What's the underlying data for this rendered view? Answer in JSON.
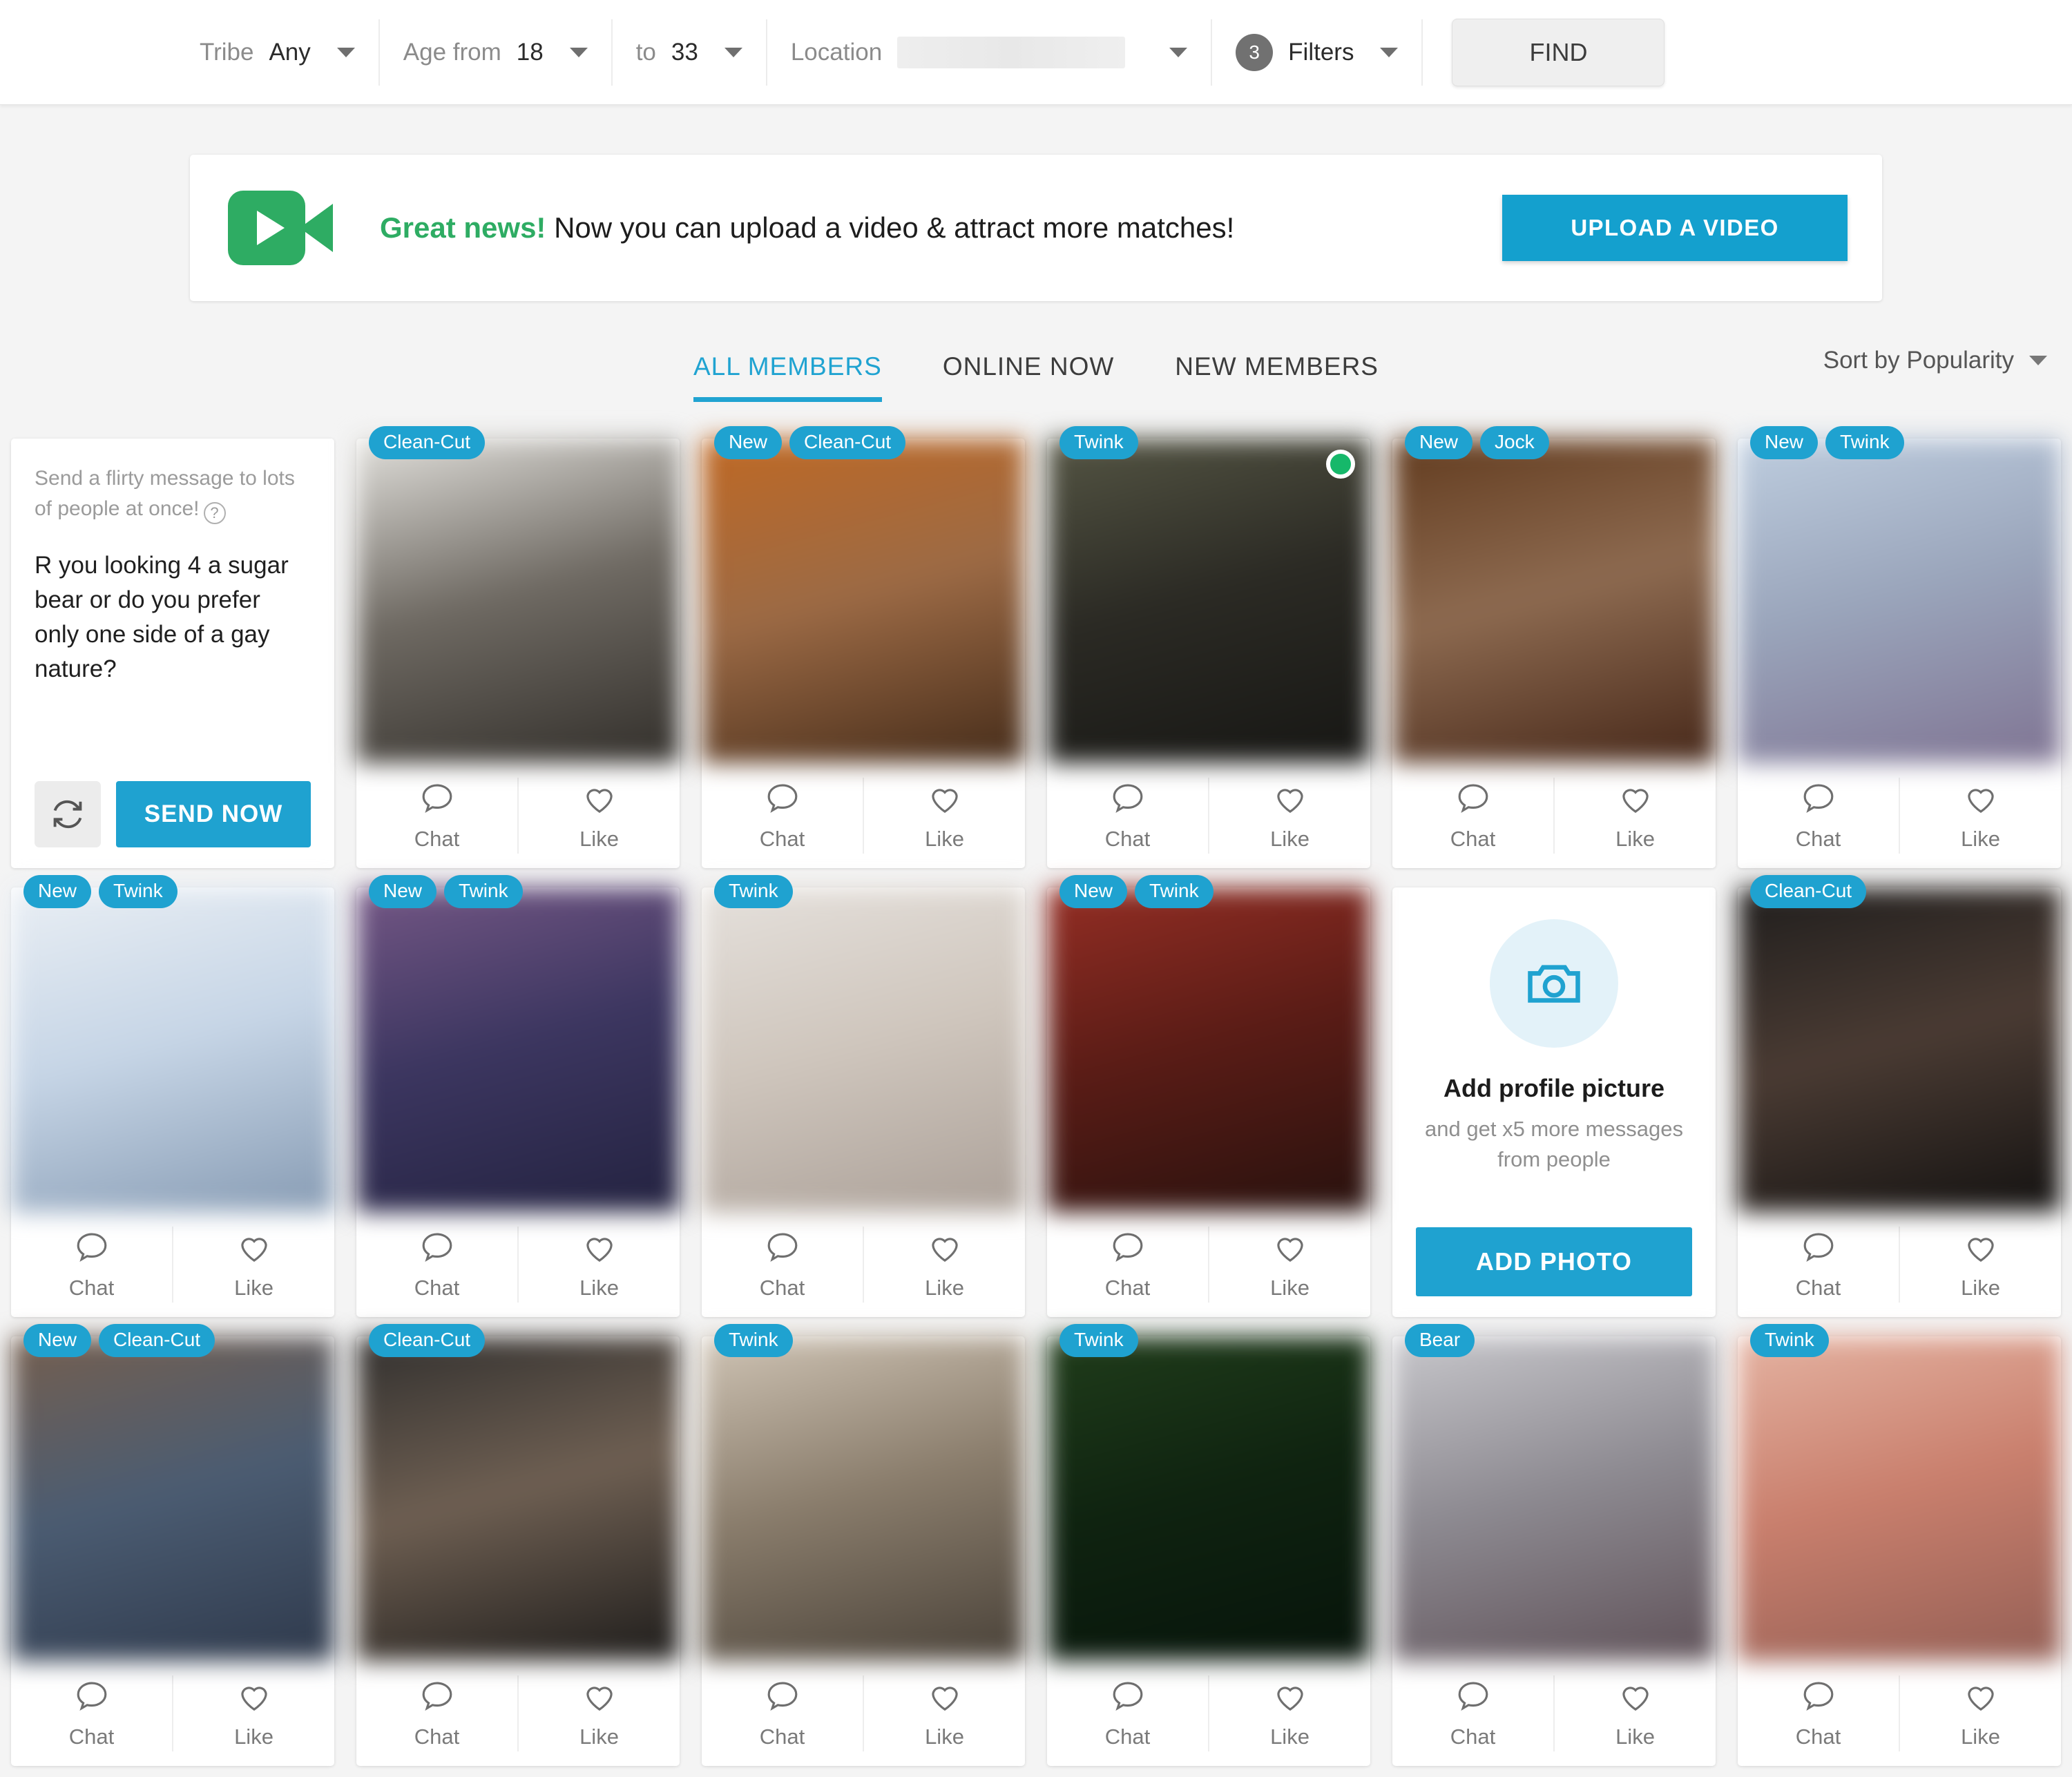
{
  "filter_bar": {
    "tribe_label": "Tribe",
    "tribe_value": "Any",
    "age_from_label": "Age from",
    "age_from_value": "18",
    "age_to_label": "to",
    "age_to_value": "33",
    "location_label": "Location",
    "location_value": "",
    "filters_count": "3",
    "filters_label": "Filters",
    "find_label": "FIND"
  },
  "promo": {
    "highlight": "Great news!",
    "text": " Now you can upload a video & attract more matches!",
    "button_label": "UPLOAD A VIDEO",
    "icon": "video-camera-icon",
    "accent_color": "#2eac63",
    "button_color": "#14a0ce"
  },
  "tabs": [
    {
      "label": "ALL MEMBERS",
      "active": true
    },
    {
      "label": "ONLINE NOW",
      "active": false
    },
    {
      "label": "NEW MEMBERS",
      "active": false
    }
  ],
  "sort": {
    "label": "Sort by Popularity"
  },
  "flirt_card": {
    "hint": "Send a flirty message to lots of people at once!",
    "help_icon": "question-mark-icon",
    "message": "R you looking 4 a sugar bear or do you prefer only one side of a gay nature?",
    "refresh_icon": "refresh-icon",
    "send_label": "SEND NOW"
  },
  "add_photo_card": {
    "icon": "camera-icon",
    "title": "Add profile picture",
    "subtitle": "and get x5 more messages from people",
    "button_label": "ADD PHOTO"
  },
  "card_actions": {
    "chat_label": "Chat",
    "like_label": "Like",
    "chat_icon": "speech-bubble-icon",
    "like_icon": "heart-icon"
  },
  "colors": {
    "badge": "#1fa2d0",
    "accent": "#20a3d1",
    "online": "#16b86a"
  },
  "members": [
    {
      "badges": [
        "Clean-Cut"
      ],
      "online": false,
      "c1": "#f0efeb",
      "c2": "#6f6a63",
      "c3": "#2a2723"
    },
    {
      "badges": [
        "New",
        "Clean-Cut"
      ],
      "online": false,
      "c1": "#c4681f",
      "c2": "#9c6a45",
      "c3": "#3a2414"
    },
    {
      "badges": [
        "Twink"
      ],
      "online": true,
      "c1": "#5a5b48",
      "c2": "#2b2a24",
      "c3": "#141412"
    },
    {
      "badges": [
        "New",
        "Jock"
      ],
      "online": false,
      "c1": "#5c3518",
      "c2": "#8d6a50",
      "c3": "#3d1f12"
    },
    {
      "badges": [
        "New",
        "Twink"
      ],
      "online": false,
      "c1": "#c3d3e4",
      "c2": "#9aa5bb",
      "c3": "#7c6e8e"
    },
    {
      "badges": [
        "New",
        "Twink"
      ],
      "online": false,
      "c1": "#eef2f6",
      "c2": "#c6d5e6",
      "c3": "#7f94ad"
    },
    {
      "badges": [
        "New",
        "Twink"
      ],
      "online": false,
      "c1": "#7b5b8a",
      "c2": "#3c3660",
      "c3": "#20203c"
    },
    {
      "badges": [
        "Twink"
      ],
      "online": false,
      "c1": "#e8e4e0",
      "c2": "#cfc6bd",
      "c3": "#a79c94"
    },
    {
      "badges": [
        "New",
        "Twink"
      ],
      "online": false,
      "c1": "#9c3026",
      "c2": "#5a1c16",
      "c3": "#21100d"
    },
    {
      "badges": [
        "Clean-Cut"
      ],
      "online": false,
      "c1": "#1a1a1a",
      "c2": "#4a3b33",
      "c3": "#0d0d0d"
    },
    {
      "badges": [
        "New",
        "Clean-Cut"
      ],
      "online": false,
      "c1": "#7a5f4a",
      "c2": "#4b5c72",
      "c3": "#2b3547"
    },
    {
      "badges": [
        "Clean-Cut"
      ],
      "online": false,
      "c1": "#2a2a2a",
      "c2": "#6e5f52",
      "c3": "#141414"
    },
    {
      "badges": [
        "Twink"
      ],
      "online": false,
      "c1": "#d8cdbe",
      "c2": "#8a7d6c",
      "c3": "#413a32"
    },
    {
      "badges": [
        "Twink"
      ],
      "online": false,
      "c1": "#22401c",
      "c2": "#0f2310",
      "c3": "#06120a"
    },
    {
      "badges": [
        "Bear"
      ],
      "online": false,
      "c1": "#cfcfd3",
      "c2": "#8d8a91",
      "c3": "#5a4b52"
    },
    {
      "badges": [
        "Twink"
      ],
      "online": false,
      "c1": "#e8b9a8",
      "c2": "#c97f6d",
      "c3": "#8d5b52"
    }
  ]
}
